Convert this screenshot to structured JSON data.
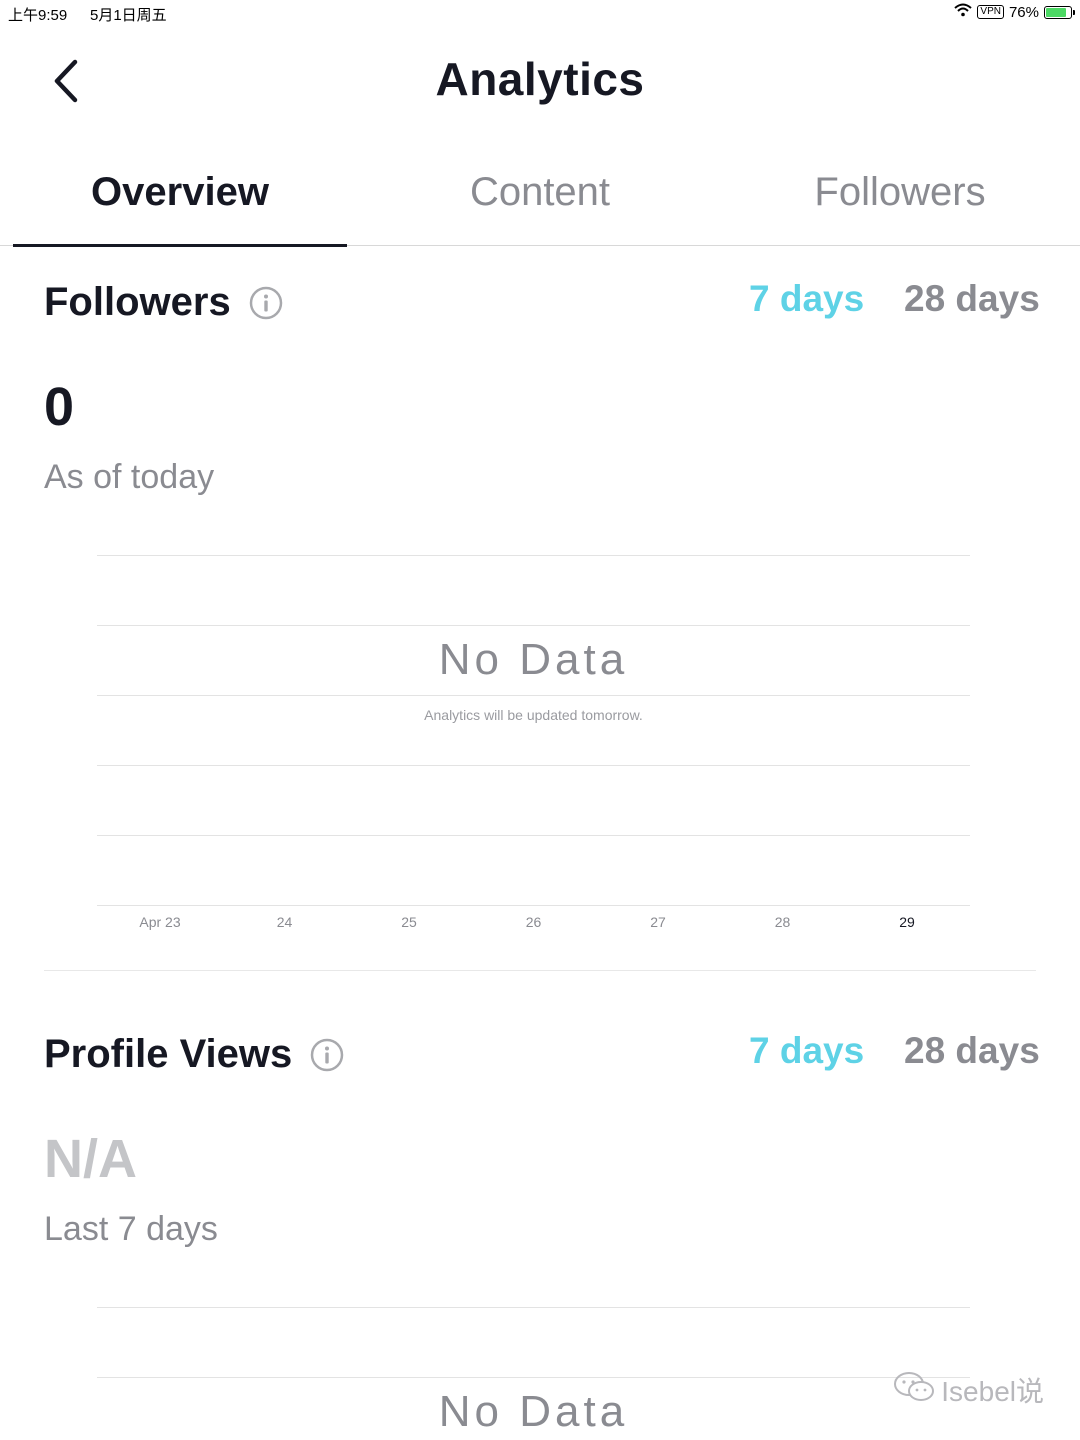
{
  "status_bar": {
    "time": "上午9:59",
    "date": "5月1日周五",
    "vpn": "VPN",
    "battery": "76%"
  },
  "header": {
    "title": "Analytics"
  },
  "tabs": [
    {
      "label": "Overview",
      "active": true
    },
    {
      "label": "Content",
      "active": false
    },
    {
      "label": "Followers",
      "active": false
    }
  ],
  "followers_section": {
    "title": "Followers",
    "period_7": "7 days",
    "period_28": "28 days",
    "value": "0",
    "value_caption": "As of today",
    "no_data": "No Data",
    "no_data_sub": "Analytics will be updated tomorrow."
  },
  "profile_views_section": {
    "title": "Profile Views",
    "period_7": "7 days",
    "period_28": "28 days",
    "value": "N/A",
    "value_caption": "Last 7 days",
    "no_data": "No Data"
  },
  "chart_data": {
    "type": "line",
    "title": "",
    "categories": [
      "Apr 23",
      "24",
      "25",
      "26",
      "27",
      "28",
      "29"
    ],
    "series": [],
    "xlabel": "",
    "ylabel": "",
    "grid": true
  },
  "watermark": "Isebel说",
  "colors": {
    "accent": "#5ed2e6",
    "text_primary": "#161823",
    "text_secondary": "#8a8b91"
  }
}
